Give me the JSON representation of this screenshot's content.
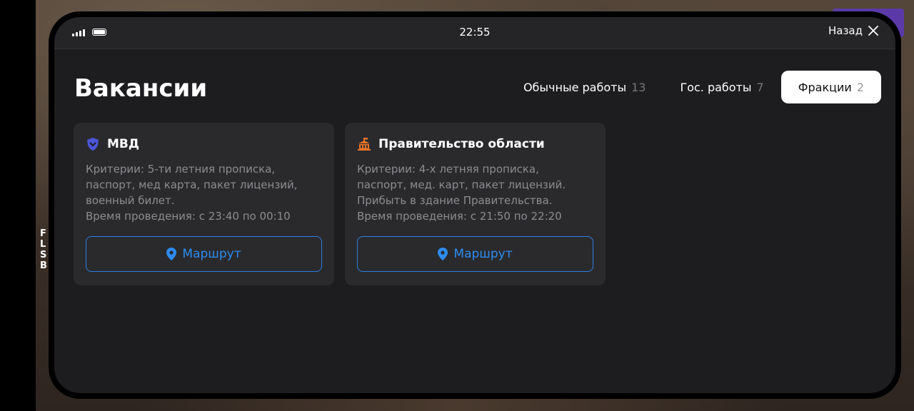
{
  "status": {
    "time": "22:55",
    "back_label": "Назад"
  },
  "page": {
    "title": "Вакансии"
  },
  "tabs": [
    {
      "label": "Обычные работы",
      "count": "13"
    },
    {
      "label": "Гос. работы",
      "count": "7"
    },
    {
      "label": "Фракции",
      "count": "2"
    }
  ],
  "cards": [
    {
      "title": "МВД",
      "icon": "shield-icon",
      "icon_color": "#4a56d8",
      "desc": [
        "Критерии: 5-ти летния прописка,",
        "паспорт, мед карта, пакет лицензий,",
        "военный билет.",
        "Время проведения: с 23:40 по 00:10"
      ],
      "button": "Маршрут"
    },
    {
      "title": "Правительство области",
      "icon": "government-building-icon",
      "icon_color": "#e8742a",
      "desc": [
        "Критерии: 4-х летняя прописка,",
        "паспорт, мед. карт, пакет лицензий.",
        "Прибыть в здание Правительства.",
        "Время проведения: с 21:50 по 22:20"
      ],
      "button": "Маршрут"
    }
  ],
  "side_letters": [
    "F",
    "L",
    "S",
    "B"
  ],
  "colors": {
    "accent": "#2d8cf0",
    "card_bg": "#2a2a2d",
    "screen_bg": "#1d1d20"
  }
}
